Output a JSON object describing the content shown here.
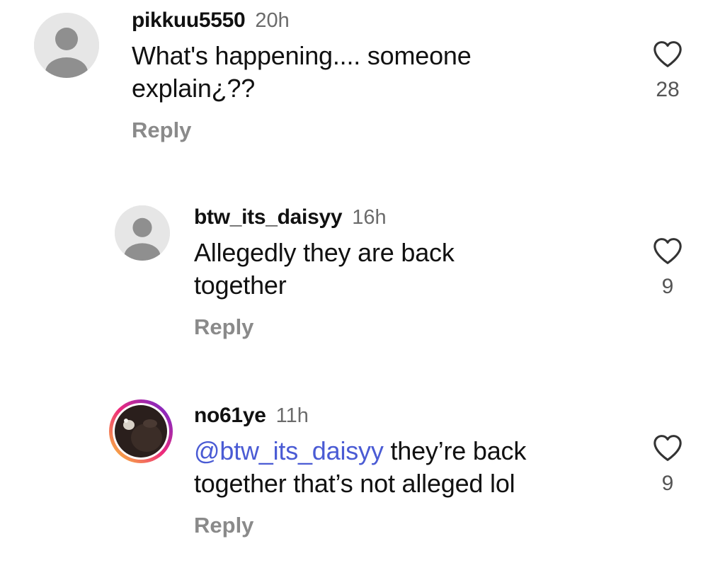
{
  "comments": [
    {
      "username": "pikkuu5550",
      "time": "20h",
      "text": "What's happening.... someone explain¿??",
      "mention": "",
      "reply_label": "Reply",
      "likes": "28",
      "avatar": "default-avatar-icon"
    },
    {
      "username": "btw_its_daisyy",
      "time": "16h",
      "text": "Allegedly they are back together",
      "mention": "",
      "reply_label": "Reply",
      "likes": "9",
      "avatar": "default-avatar-icon"
    },
    {
      "username": "no61ye",
      "time": "11h",
      "mention": "@btw_its_daisyy",
      "text": " they’re back together that’s not alleged lol",
      "reply_label": "Reply",
      "likes": "9",
      "avatar": "story-ring-avatar"
    }
  ],
  "colors": {
    "mention": "#4a5bd4",
    "time": "#6b6b6b",
    "reply": "#8a8a8a",
    "avatar_bg": "#e6e6e6",
    "avatar_fg": "#8f8f8f",
    "story_ring": [
      "#f9ce34",
      "#ee2a7b",
      "#6228d7"
    ]
  }
}
